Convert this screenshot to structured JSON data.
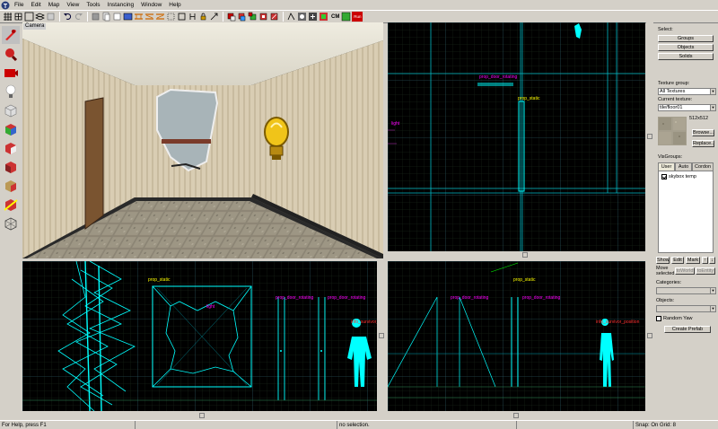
{
  "menu": [
    "File",
    "Edit",
    "Map",
    "View",
    "Tools",
    "Instancing",
    "Window",
    "Help"
  ],
  "toolbar": {
    "cordon_label": "CM",
    "run_label": "Run"
  },
  "camera_view": {
    "label": "Camera"
  },
  "top_view": {
    "labels": {
      "prop_static": "prop_static",
      "door": "prop_door_rotating",
      "light": "light"
    }
  },
  "front_view": {
    "labels": {
      "prop_static": "prop_static",
      "light": "light",
      "door1": "prop_door_rotating",
      "door2": "prop_door_rotating",
      "survivor": "info_survivor_position"
    }
  },
  "side_view": {
    "labels": {
      "prop_static": "prop_static",
      "door1": "prop_door_rotating",
      "door2": "prop_door_rotating",
      "survivor": "info_survivor_position"
    }
  },
  "right_panel": {
    "select_label": "Select:",
    "groups_btn": "Groups",
    "objects_btn": "Objects",
    "solids_btn": "Solids",
    "texture_group_label": "Texture group:",
    "texture_group_value": "All Textures",
    "current_texture_label": "Current texture:",
    "current_texture_value": "tile/floor01",
    "texture_size": "512x512",
    "browse_btn": "Browse...",
    "replace_btn": "Replace...",
    "visgroups_label": "VisGroups:",
    "tabs": [
      "User",
      "Auto",
      "Cordon"
    ],
    "visgroup_items": [
      {
        "label": "skybox temp",
        "checked": true
      }
    ],
    "show_btn": "Show",
    "edit_btn": "Edit",
    "mark_btn": "Mark",
    "move_selected_label": "Move selected:",
    "to_world_btn": "toWorld",
    "to_entity_btn": "toEntity",
    "categories_label": "Categories:",
    "objects_label": "Objects:",
    "random_yaw_label": "Random Yaw",
    "create_prefab_btn": "Create Prefab"
  },
  "status": {
    "help": "For Help, press F1",
    "selection": "no selection.",
    "snap": "Snap: On Grid: 8"
  },
  "colors": {
    "grid_minor": "#1d2f1d",
    "grid_major": "#2b5b70",
    "wire": "#00ffff",
    "entity_label": "#ff00ff",
    "selected_label": "#ffff00",
    "red_label": "#ff3030"
  }
}
